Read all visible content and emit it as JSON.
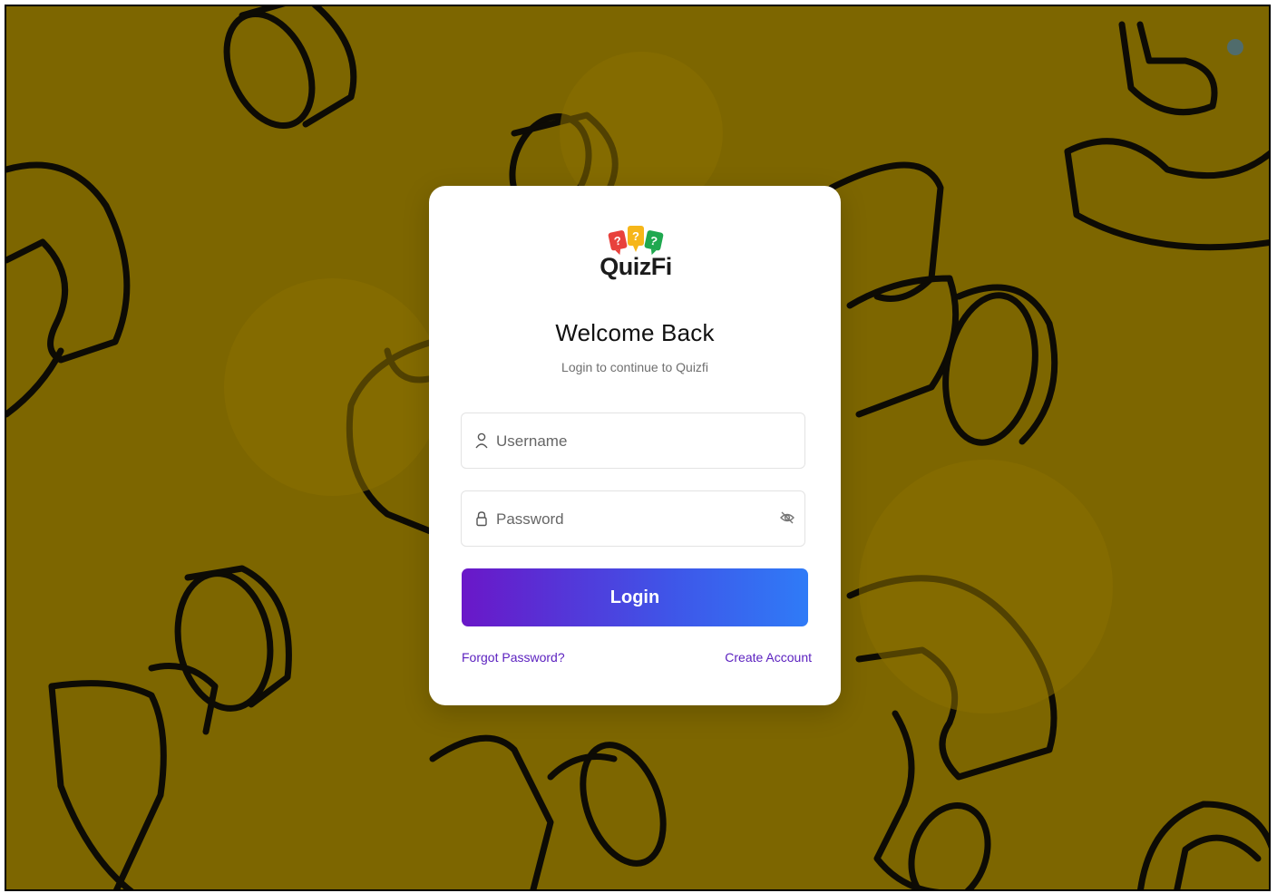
{
  "app": {
    "name": "QuizFi"
  },
  "logo": {
    "text": "QuizFi",
    "bubble_glyph": "?"
  },
  "login_card": {
    "title": "Welcome Back",
    "subtitle": "Login to continue to Quizfi",
    "username": {
      "placeholder": "Username",
      "value": "",
      "icon": "user-icon"
    },
    "password": {
      "placeholder": "Password",
      "value": "",
      "icon": "lock-icon",
      "toggle_icon": "eye-off-icon"
    },
    "login_label": "Login",
    "forgot_label": "Forgot Password?",
    "create_label": "Create Account"
  },
  "colors": {
    "background": "#7d6600",
    "accent_start": "#6a17c8",
    "accent_end": "#2f7bf7",
    "link": "#5a1fbf",
    "logo_red": "#e8413c",
    "logo_yellow": "#f6b619",
    "logo_green": "#1fa84f"
  }
}
